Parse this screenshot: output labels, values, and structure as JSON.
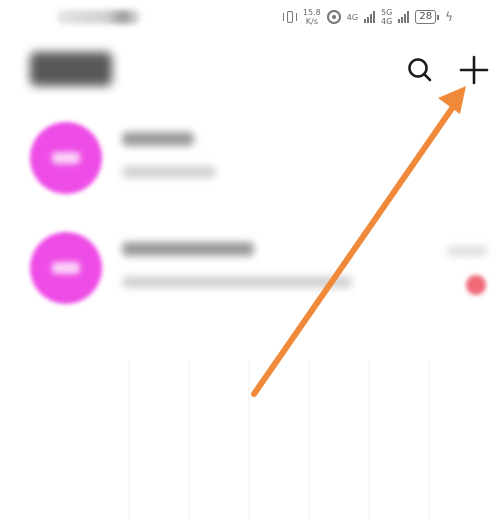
{
  "status_bar": {
    "speed_value": "15.8",
    "speed_unit": "K/s",
    "net1": "4G",
    "net2": "5G",
    "net2b": "4G",
    "battery": "28"
  },
  "icons": {
    "search": "search-icon",
    "add": "plus-icon"
  },
  "colors": {
    "avatar": "#ee4ce6",
    "badge": "#f06a78",
    "annotation_arrow": "#f08a3a"
  },
  "annotation": {
    "arrow_target": "add-button"
  }
}
